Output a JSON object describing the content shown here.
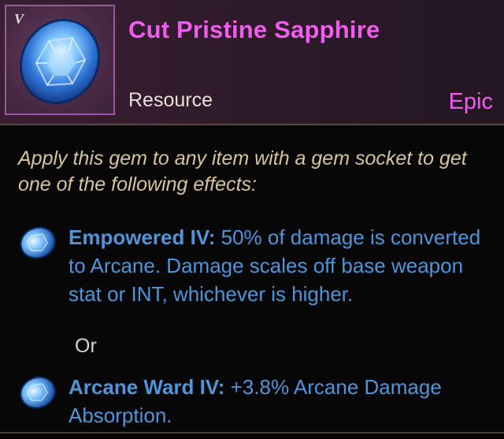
{
  "tooltip": {
    "tier": "V",
    "name": "Cut Pristine Sapphire",
    "type": "Resource",
    "rarity": "Epic",
    "description": "Apply this gem to any item with a gem socket to get one of the following effects:",
    "effects": [
      {
        "name": "Empowered IV:",
        "text": "50% of damage is converted to Arcane. Damage scales off base weapon stat or INT, whichever is higher.",
        "icon": "sapphire-gem-icon"
      },
      {
        "name": "Arcane Ward IV:",
        "text": "+3.8% Arcane Damage Absorption.",
        "icon": "sapphire-gem-icon"
      }
    ],
    "separator": "Or"
  },
  "colors": {
    "name": "#f15cf0",
    "rarity": "#f15cf0",
    "description": "#d7c39c",
    "effect": "#4f95d8",
    "header_bg": "#3a1f33",
    "body_bg": "#070707"
  }
}
